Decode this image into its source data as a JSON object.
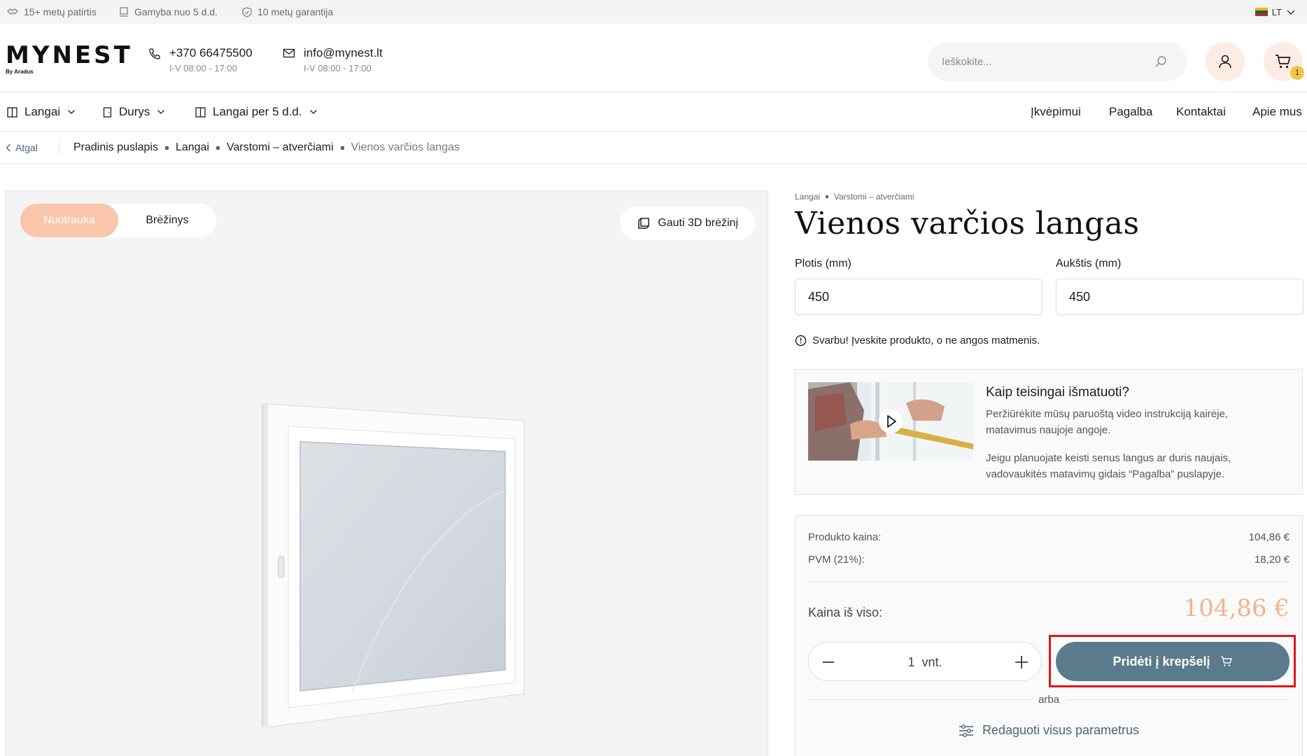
{
  "topbar": {
    "features": [
      {
        "icon": "experience-icon",
        "label": "15+ metų patirtis"
      },
      {
        "icon": "production-icon",
        "label": "Gamyba nuo 5 d.d."
      },
      {
        "icon": "shield-icon",
        "label": "10 metų garantija"
      }
    ],
    "language": "LT"
  },
  "header": {
    "logo": "MYNEST",
    "logo_sub": "By Aradus",
    "phone": "+370 66475500",
    "phone_hours": "I-V 08:00 - 17:00",
    "email": "info@mynest.lt",
    "email_hours": "I-V 08:00 - 17:00",
    "search_placeholder": "Ieškokite...",
    "cart_count": "1"
  },
  "nav": {
    "left": [
      {
        "label": "Langai"
      },
      {
        "label": "Durys"
      },
      {
        "label": "Langai per 5 d.d."
      }
    ],
    "right": [
      "Įkvėpimui",
      "Pagalba",
      "Kontaktai",
      "Apie mus"
    ]
  },
  "breadcrumb": {
    "back": "Atgal",
    "items": [
      "Pradinis puslapis",
      "Langai",
      "Varstomi – atverčiami",
      "Vienos varčios langas"
    ]
  },
  "gallery": {
    "tabs": [
      "Nuotrauka",
      "Brėžinys"
    ],
    "active_tab": "Nuotrauka",
    "get_3d": "Gauti 3D brėžinį"
  },
  "product": {
    "mini_crumbs": [
      "Langai",
      "Varstomi – atverčiami"
    ],
    "title": "Vienos varčios langas",
    "width_label": "Plotis (mm)",
    "width_value": "450",
    "height_label": "Aukštis (mm)",
    "height_value": "450",
    "warning": "Svarbu! Įveskite produkto, o ne angos matmenis."
  },
  "measure": {
    "title": "Kaip teisingai išmatuoti?",
    "text1": "Peržiūrėkite mūsų paruoštą video instrukciją kairėje, matavimus naujoje angoje.",
    "text2": "Jeigu planuojate keisti senus langus ar duris naujais, vadovaukitės matavimų gidais “Pagalba” puslapyje."
  },
  "pricing": {
    "product_price_label": "Produkto kaina:",
    "product_price": "104,86 €",
    "vat_label": "PVM (21%):",
    "vat": "18,20 €",
    "total_label": "Kaina iš viso:",
    "total": "104,86 €",
    "quantity": "1",
    "unit": "vnt.",
    "add_to_cart": "Pridėti į krepšelį",
    "or": "arba",
    "edit_params": "Redaguoti visus parametrus"
  },
  "colors": {
    "accent_peach": "#f9c6ab",
    "price_color": "#f0b48e",
    "button_slate": "#5b7b8c",
    "highlight_red": "#e0161c"
  }
}
